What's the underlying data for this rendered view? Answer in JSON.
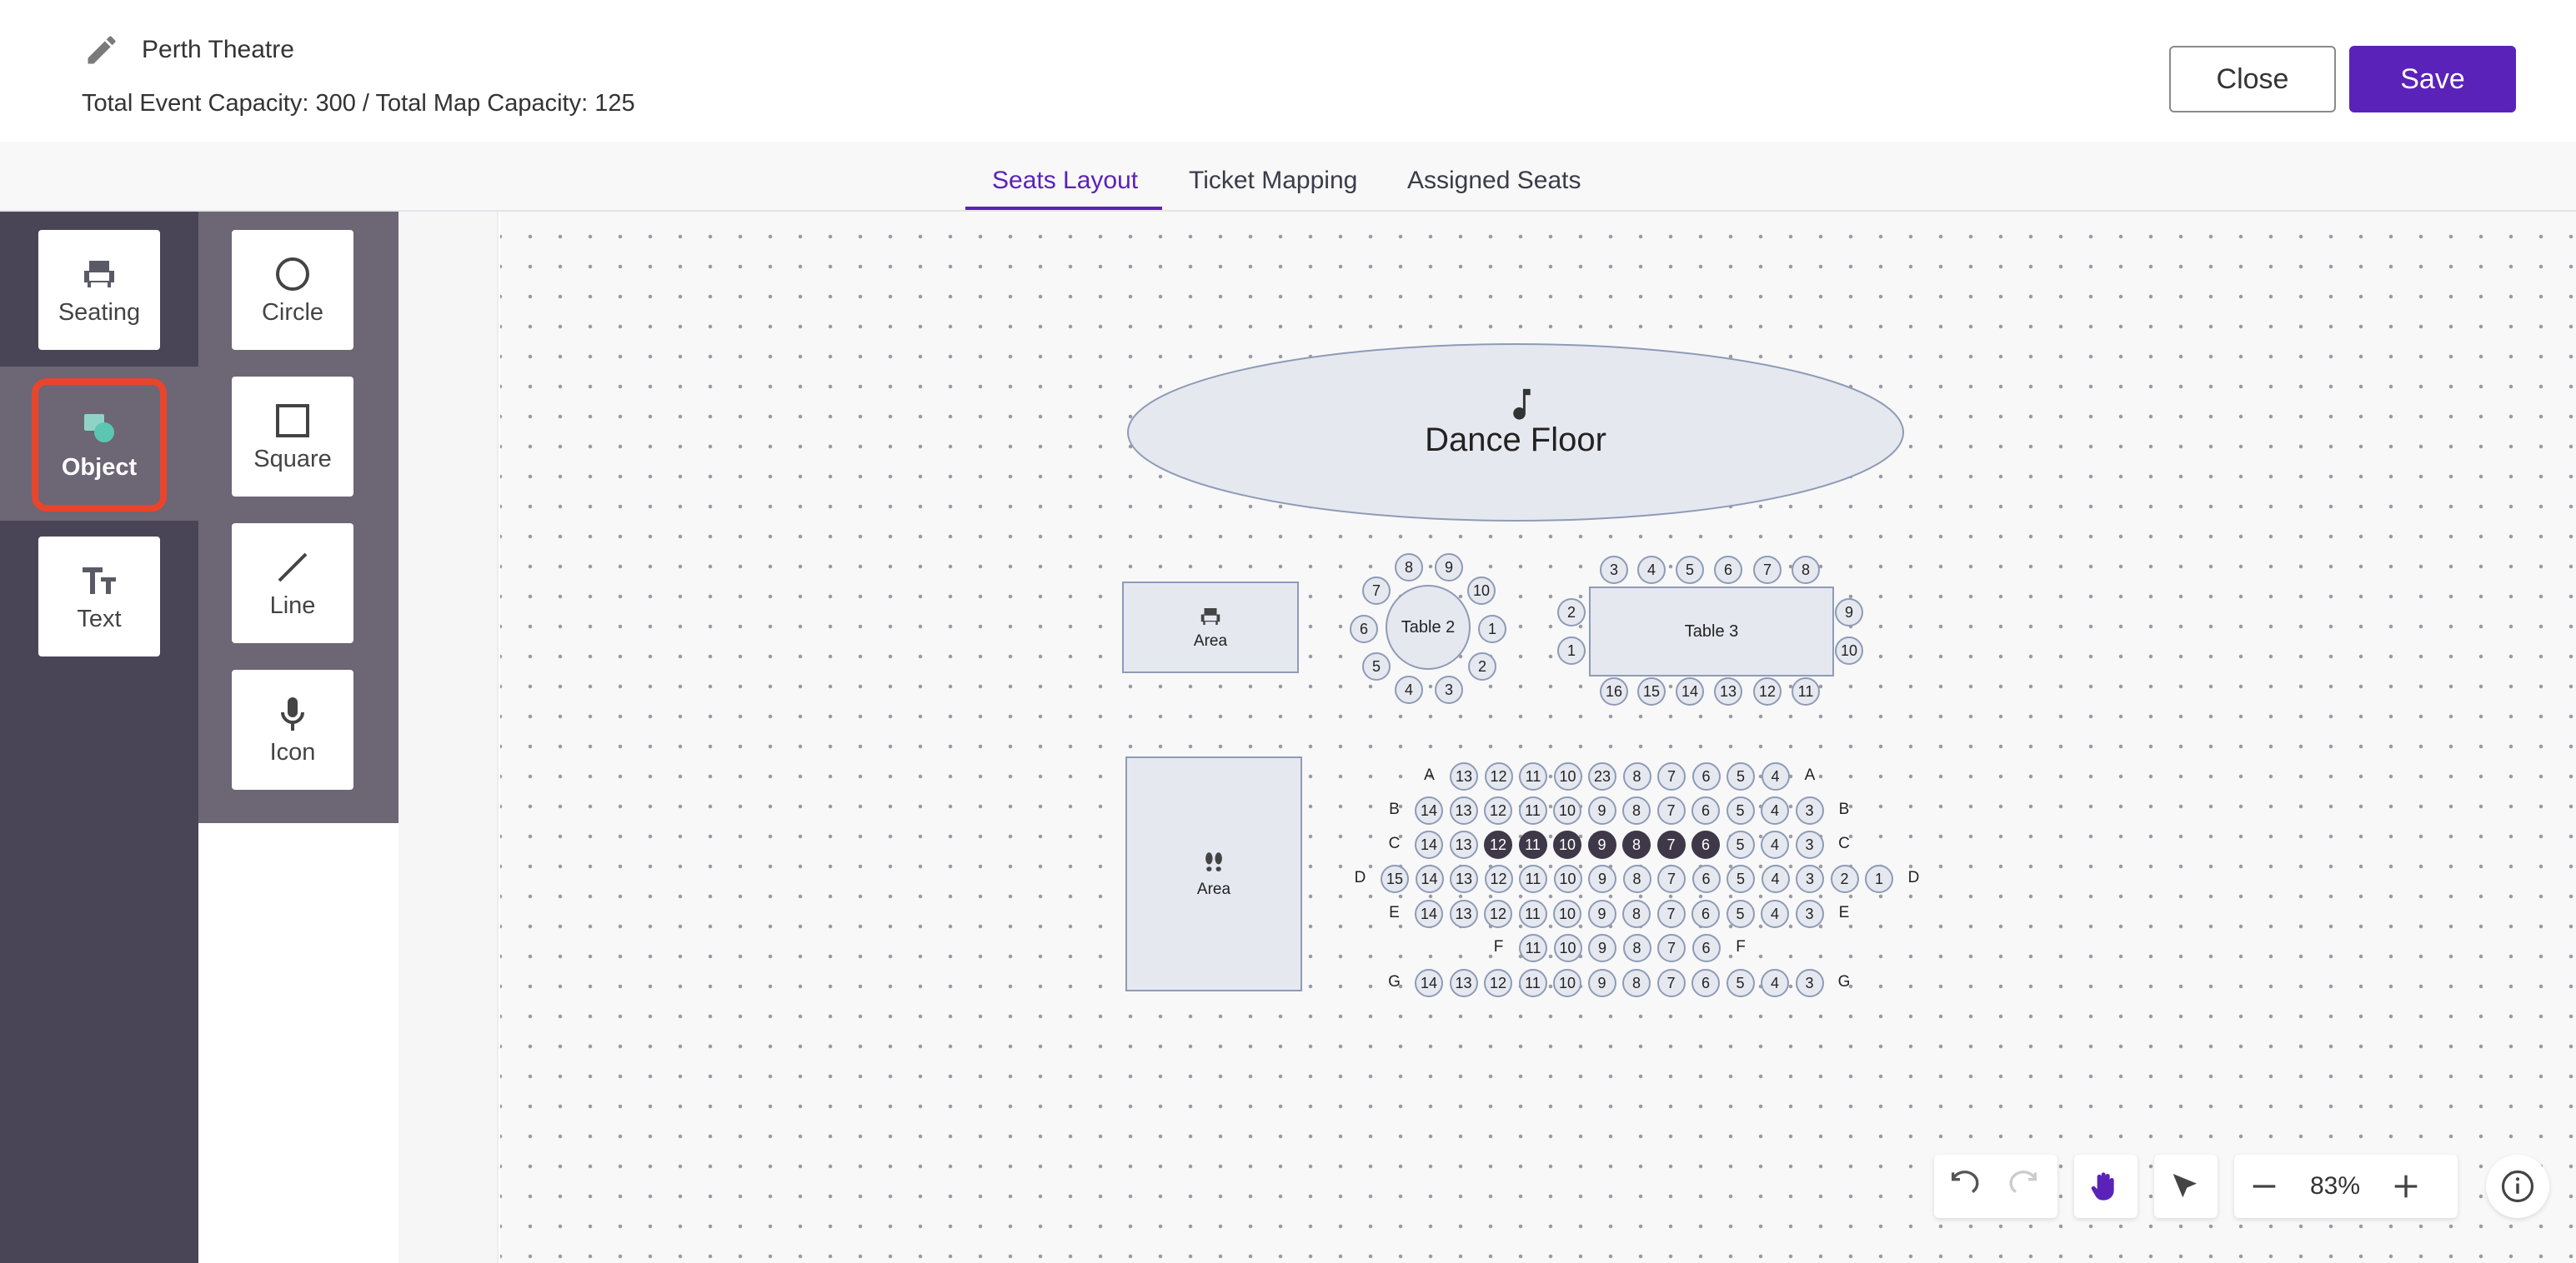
{
  "header": {
    "map_name": "Perth Theatre",
    "capacity": "Total Event Capacity: 300 / Total Map Capacity: 125",
    "close_label": "Close",
    "save_label": "Save",
    "accent": "#5a22b8"
  },
  "tabs": [
    {
      "label": "Seats Layout",
      "active": true
    },
    {
      "label": "Ticket Mapping",
      "active": false
    },
    {
      "label": "Assigned Seats",
      "active": false
    }
  ],
  "tools": {
    "primary": [
      {
        "label": "Seating",
        "icon": "seat-icon"
      },
      {
        "label": "Object",
        "icon": "object-shapes-icon",
        "selected": true
      },
      {
        "label": "Text",
        "icon": "text-icon"
      }
    ],
    "secondary": [
      {
        "label": "Circle",
        "icon": "circle-icon"
      },
      {
        "label": "Square",
        "icon": "square-icon"
      },
      {
        "label": "Line",
        "icon": "line-icon"
      },
      {
        "label": "Icon",
        "icon": "microphone-icon"
      }
    ]
  },
  "canvas": {
    "dance_floor": "Dance Floor",
    "area_top": "Area",
    "area_bottom": "Area",
    "table2": {
      "label": "Table 2",
      "seats": [
        "8",
        "9",
        "10",
        "1",
        "2",
        "3",
        "4",
        "5",
        "6",
        "7"
      ]
    },
    "table3": {
      "label": "Table 3",
      "top_seats": [
        "3",
        "4",
        "5",
        "6",
        "7",
        "8"
      ],
      "bottom_seats": [
        "16",
        "15",
        "14",
        "13",
        "12",
        "11"
      ],
      "left_seats": [
        "2",
        "1"
      ],
      "right_seats": [
        "9",
        "10"
      ]
    },
    "rows": [
      {
        "letter": "A",
        "seats": [
          "13",
          "12",
          "11",
          "10",
          "23",
          "8",
          "7",
          "6",
          "5",
          "4"
        ],
        "filled": []
      },
      {
        "letter": "B",
        "seats": [
          "14",
          "13",
          "12",
          "11",
          "10",
          "9",
          "8",
          "7",
          "6",
          "5",
          "4",
          "3"
        ],
        "filled": []
      },
      {
        "letter": "C",
        "seats": [
          "14",
          "13",
          "12",
          "11",
          "10",
          "9",
          "8",
          "7",
          "6",
          "5",
          "4",
          "3"
        ],
        "filled": [
          "12",
          "11",
          "10",
          "9",
          "8",
          "7",
          "6"
        ]
      },
      {
        "letter": "D",
        "seats": [
          "15",
          "14",
          "13",
          "12",
          "11",
          "10",
          "9",
          "8",
          "7",
          "6",
          "5",
          "4",
          "3",
          "2",
          "1"
        ],
        "filled": []
      },
      {
        "letter": "E",
        "seats": [
          "14",
          "13",
          "12",
          "11",
          "10",
          "9",
          "8",
          "7",
          "6",
          "5",
          "4",
          "3"
        ],
        "filled": []
      },
      {
        "letter": "F",
        "seats": [
          "11",
          "10",
          "9",
          "8",
          "7",
          "6"
        ],
        "filled": []
      },
      {
        "letter": "G",
        "seats": [
          "14",
          "13",
          "12",
          "11",
          "10",
          "9",
          "8",
          "7",
          "6",
          "5",
          "4",
          "3"
        ],
        "filled": []
      }
    ]
  },
  "toolbar": {
    "zoom": "83%"
  }
}
